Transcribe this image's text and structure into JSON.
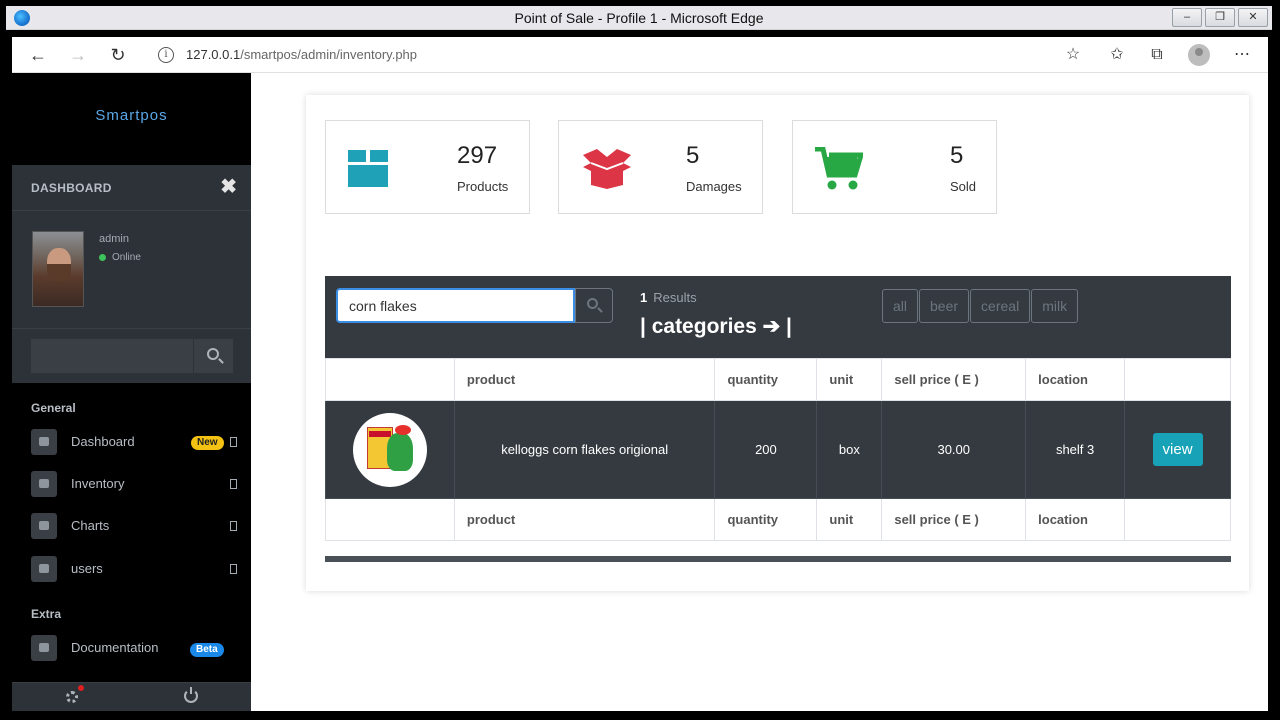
{
  "window": {
    "title": "Point of Sale - Profile 1 - Microsoft Edge",
    "url_host": "127.0.0.1",
    "url_path": "/smartpos/admin/inventory.php"
  },
  "sidebar": {
    "brand": "Smartpos",
    "header": "DASHBOARD",
    "user": {
      "name": "admin",
      "status": "Online"
    },
    "sections": {
      "general": "General",
      "extra": "Extra"
    },
    "items": [
      {
        "label": "Dashboard",
        "badge": "New"
      },
      {
        "label": "Inventory"
      },
      {
        "label": "Charts"
      },
      {
        "label": "users"
      },
      {
        "label": "Documentation",
        "badge": "Beta"
      }
    ]
  },
  "stats": [
    {
      "value": "297",
      "label": "Products",
      "icon": "box-icon",
      "color": "#1fa2b8"
    },
    {
      "value": "5",
      "label": "Damages",
      "icon": "open-box-icon",
      "color": "#dc3545"
    },
    {
      "value": "5",
      "label": "Sold",
      "icon": "cart-icon",
      "color": "#28a745"
    }
  ],
  "search": {
    "value": "corn flakes",
    "results_count": "1",
    "results_label": "Results",
    "categories_label": "| categories ➔ |",
    "filters": [
      "all",
      "beer",
      "cereal",
      "milk"
    ]
  },
  "table": {
    "headers": [
      "",
      "product",
      "quantity",
      "unit",
      "sell price ( E )",
      "location",
      ""
    ],
    "rows": [
      {
        "product": "kelloggs corn flakes origional",
        "quantity": "200",
        "unit": "box",
        "price": "30.00",
        "location": "shelf 3",
        "action": "view"
      }
    ]
  }
}
